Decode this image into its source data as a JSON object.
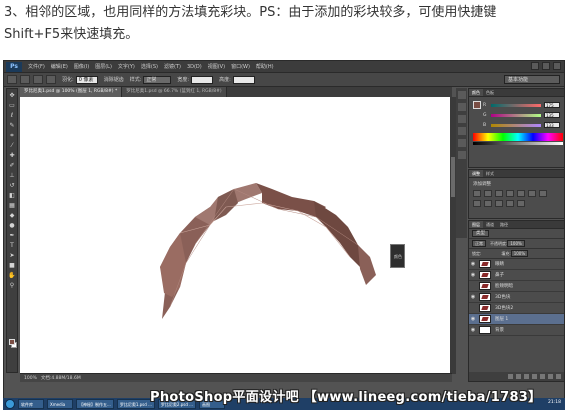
{
  "caption": {
    "line1": "3、相邻的区域，也用同样的方法填充彩块。PS：由于添加的彩块较多，可使用快捷键",
    "line2": "Shift+F5来快速填充。"
  },
  "app": {
    "logo": "Ps",
    "menus": [
      "文件(F)",
      "编辑(E)",
      "图像(I)",
      "图层(L)",
      "文字(Y)",
      "选择(S)",
      "滤镜(T)",
      "3D(D)",
      "视图(V)",
      "窗口(W)",
      "帮助(H)"
    ],
    "workspace": "基本功能"
  },
  "options": {
    "feather_label": "羽化:",
    "feather_value": "0 像素",
    "antialias_label": "消除锯齿",
    "style_label": "样式:",
    "style_value": "正常",
    "width_label": "宽度:",
    "height_label": "高度:"
  },
  "tabs": [
    "罗比尼奥1.psd @ 100% (图层 1, RGB/8#) *",
    "罗比尼奥1.psd @ 66.7% (蓝到红 1, RGB/8#)"
  ],
  "status": {
    "zoom": "100%",
    "doc": "文档:4.88M/18.6M"
  },
  "color_panel": {
    "tabs": [
      "颜色",
      "色板"
    ],
    "sliders": [
      {
        "label": "R",
        "value": "175",
        "color": "#b0605a"
      },
      {
        "label": "G",
        "value": "135",
        "color": "#5aa05a"
      },
      {
        "label": "B",
        "value": "133",
        "color": "#5a6ab0"
      }
    ]
  },
  "adjust_panel": {
    "tabs": [
      "调整",
      "样式"
    ],
    "title": "添加调整"
  },
  "layers_panel": {
    "tabs": [
      "图层",
      "通道",
      "路径"
    ],
    "kind": "类型",
    "blend": "正常",
    "opacity_label": "不透明度:",
    "opacity": "100%",
    "lock_label": "锁定:",
    "fill_label": "填充:",
    "fill": "100%",
    "layers": [
      {
        "name": "眼睛",
        "visible": true,
        "selected": false
      },
      {
        "name": "鼻子",
        "visible": true,
        "selected": false
      },
      {
        "name": "脸颊明暗",
        "visible": false,
        "selected": false
      },
      {
        "name": "3D色块",
        "visible": true,
        "selected": false
      },
      {
        "name": "3D色块2",
        "visible": false,
        "selected": false
      },
      {
        "name": "图层 1",
        "visible": true,
        "selected": true
      },
      {
        "name": "背景",
        "visible": true,
        "selected": false
      }
    ]
  },
  "popup_label": "颜色",
  "taskbar": {
    "buttons": [
      "软件库",
      "Xmedia",
      "【神秘】制作五...",
      "罗比尼奥1.psd ...",
      "罗比尼奥2.psd ...",
      "画图"
    ],
    "clock": "21:18"
  },
  "watermark": "PhotoShop平面设计吧 【www.lineeg.com/tieba/1783】",
  "colors": {
    "shape_fill": "#8a6058",
    "shape_light": "#a07870",
    "shape_dark": "#6e4840",
    "ps_bg": "#535353",
    "selected_layer": "#5b6f8f"
  }
}
